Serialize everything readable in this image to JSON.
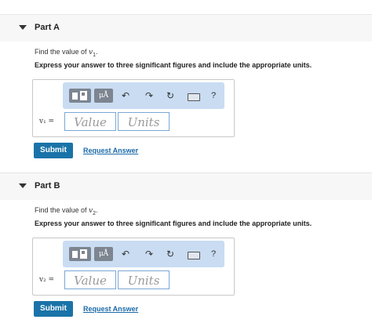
{
  "parts": [
    {
      "title": "Part A",
      "prompt_text": "Find the value of ",
      "prompt_var": "v",
      "prompt_sub": "1",
      "instruction": "Express your answer to three significant figures and include the appropriate units.",
      "var_label": "v₁ =",
      "value_placeholder": "Value",
      "units_placeholder": "Units",
      "submit_label": "Submit",
      "request_label": "Request Answer"
    },
    {
      "title": "Part B",
      "prompt_text": "Find the value of ",
      "prompt_var": "v",
      "prompt_sub": "2",
      "instruction": "Express your answer to three significant figures and include the appropriate units.",
      "var_label": "v₂ =",
      "value_placeholder": "Value",
      "units_placeholder": "Units",
      "submit_label": "Submit",
      "request_label": "Request Answer"
    }
  ],
  "toolbar": {
    "units_label": "μÅ",
    "help_label": "?",
    "icons": [
      "templates-icon",
      "units-icon",
      "undo-icon",
      "redo-icon",
      "reset-icon",
      "keyboard-icon",
      "help-icon"
    ]
  }
}
